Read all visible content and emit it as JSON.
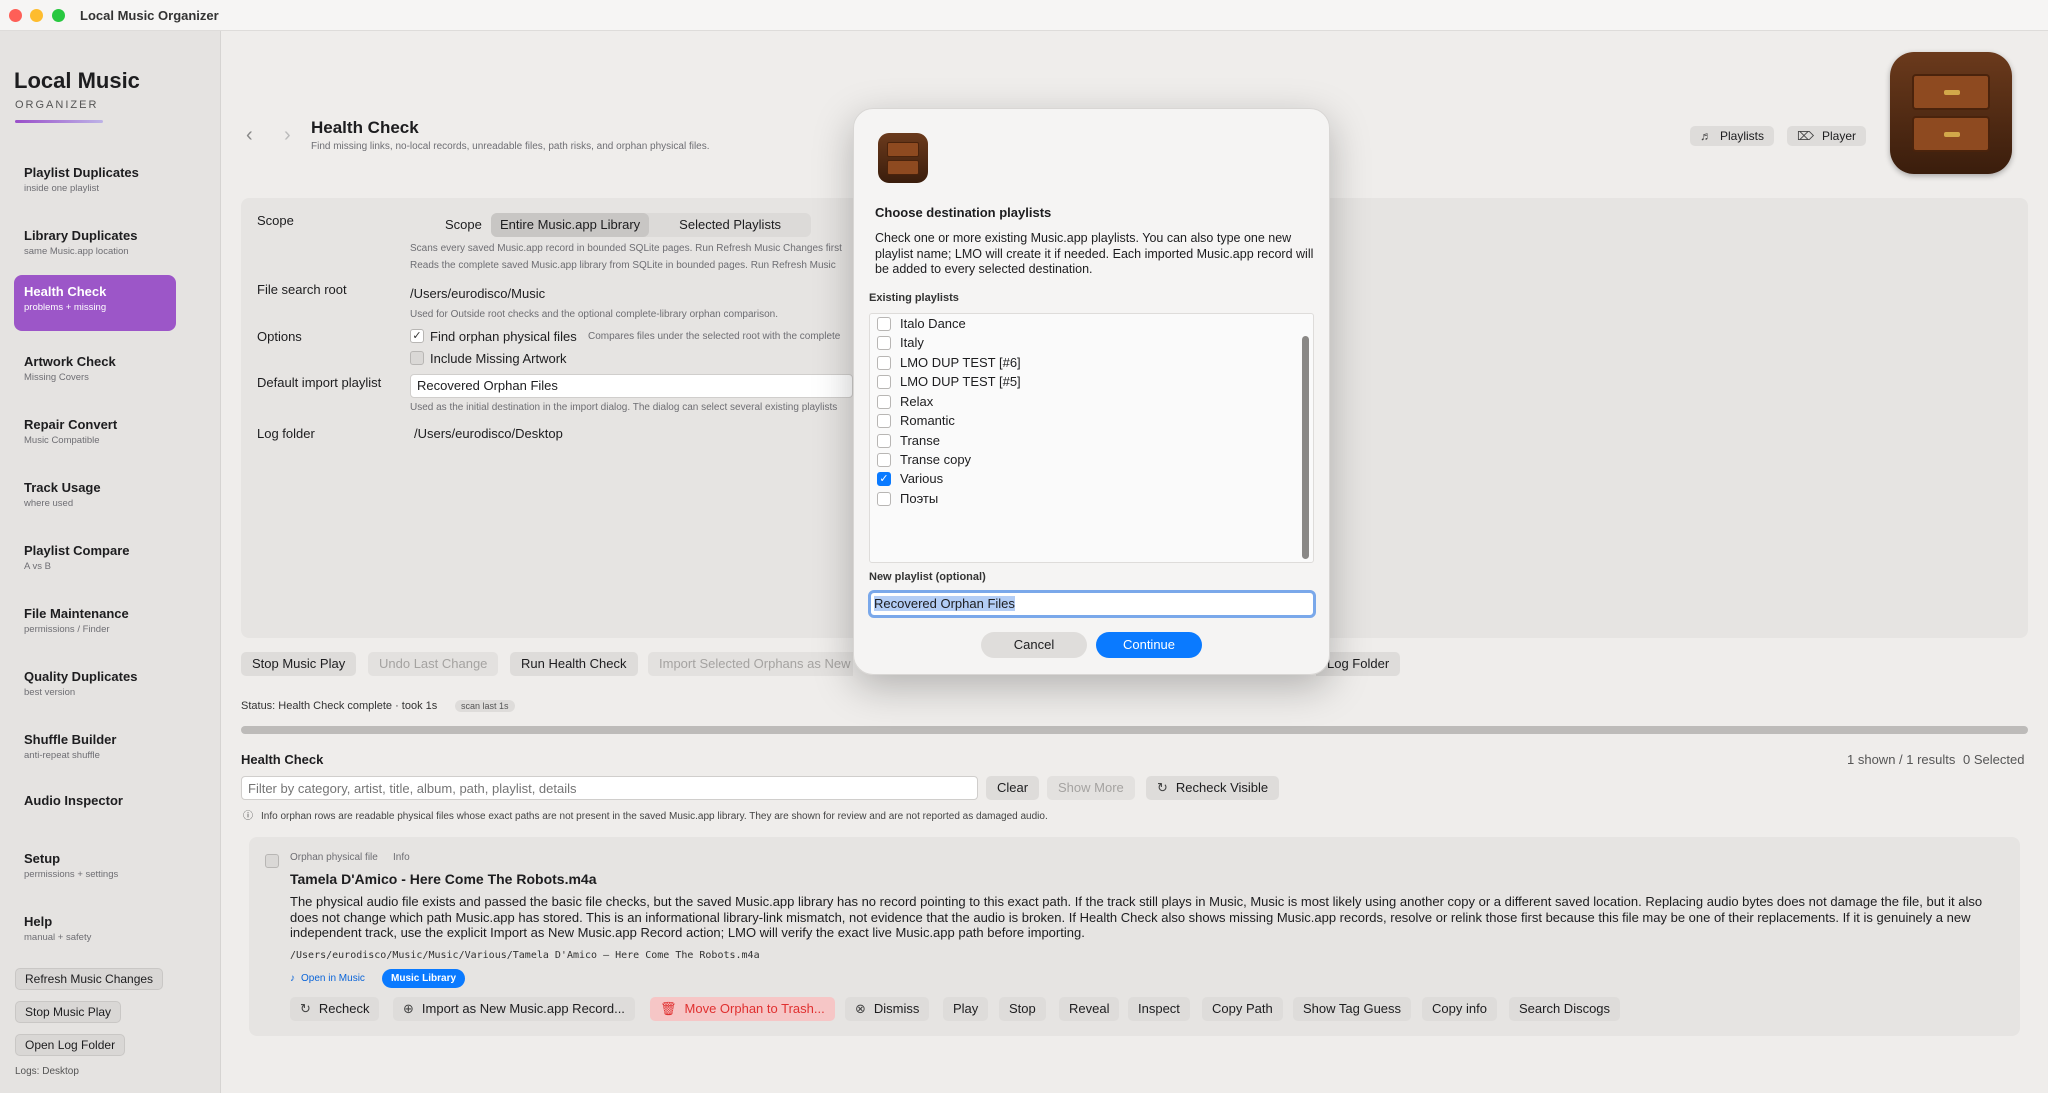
{
  "window": {
    "title": "Local Music Organizer"
  },
  "brand": {
    "line1": "Local Music",
    "line2": "ORGANIZER"
  },
  "sidebar": {
    "items": [
      {
        "title": "Playlist Duplicates",
        "sub": "inside one playlist"
      },
      {
        "title": "Library Duplicates",
        "sub": "same Music.app location"
      },
      {
        "title": "Health Check",
        "sub": "problems + missing"
      },
      {
        "title": "Artwork Check",
        "sub": "Missing Covers"
      },
      {
        "title": "Repair Convert",
        "sub": "Music Compatible"
      },
      {
        "title": "Track Usage",
        "sub": "where used"
      },
      {
        "title": "Playlist Compare",
        "sub": "A vs B"
      },
      {
        "title": "File Maintenance",
        "sub": "permissions / Finder"
      },
      {
        "title": "Quality Duplicates",
        "sub": "best version"
      },
      {
        "title": "Shuffle Builder",
        "sub": "anti-repeat shuffle"
      },
      {
        "title": "Audio Inspector",
        "sub": ""
      },
      {
        "title": "Setup",
        "sub": "permissions + settings"
      },
      {
        "title": "Help",
        "sub": "manual + safety"
      }
    ],
    "buttons": {
      "refresh": "Refresh Music Changes",
      "stop": "Stop Music Play",
      "openlog": "Open Log Folder"
    },
    "logs": "Logs: Desktop"
  },
  "header": {
    "title": "Health Check",
    "subtitle": "Find missing links, no-local records, unreadable files, path risks, and orphan physical files.",
    "playlists": "Playlists",
    "player": "Player"
  },
  "settings": {
    "scope_label": "Scope",
    "scope_inline": "Scope",
    "scope_options": [
      "Entire Music.app Library",
      "Selected Playlists"
    ],
    "scope_help1": "Scans every saved Music.app record in bounded SQLite pages. Run Refresh Music Changes first",
    "scope_help2": "Reads the complete saved Music.app library from SQLite in bounded pages. Run Refresh Music",
    "root_label": "File search root",
    "root_value": "/Users/eurodisco/Music",
    "root_help": "Used for Outside root checks and the optional complete-library orphan comparison.",
    "options_label": "Options",
    "opt1": "Find orphan physical files",
    "opt1_help": "Compares files under the selected root with the complete",
    "opt2": "Include Missing Artwork",
    "import_label": "Default import playlist",
    "import_value": "Recovered Orphan Files",
    "import_help": "Used as the initial destination in the import dialog. The dialog can select several existing playlists",
    "log_label": "Log folder",
    "log_value": "/Users/eurodisco/Desktop"
  },
  "actions": {
    "stop": "Stop Music Play",
    "undo": "Undo Last Change",
    "run": "Run Health Check",
    "import": "Import Selected Orphans as New",
    "logfolder": "Log Folder"
  },
  "status": {
    "text": "Status: Health Check complete · took 1s",
    "badge": "scan last 1s"
  },
  "results": {
    "title": "Health Check",
    "shown": "1 shown / 1 results",
    "selected": "0 Selected",
    "filter_placeholder": "Filter by category, artist, title, album, path, playlist, details",
    "clear": "Clear",
    "show_more": "Show More",
    "recheck_visible": "Recheck Visible",
    "info": "Info orphan rows are readable physical files whose exact paths are not present in the saved Music.app library. They are shown for review and are not reported as damaged audio."
  },
  "card": {
    "category": "Orphan physical file",
    "severity": "Info",
    "title": "Tamela D'Amico - Here Come The Robots.m4a",
    "body": "The physical audio file exists and passed the basic file checks, but the saved Music.app library has no record pointing to this exact path. If the track still plays in Music, Music is most likely using another copy or a different saved location. Replacing audio bytes does not damage the file, but it also does not change which path Music.app has stored. This is an informational library-link mismatch, not evidence that the audio is broken. If Health Check also shows missing Music.app records, resolve or relink those first because this file may be one of their replacements. If it is genuinely a new independent track, use the explicit Import as New Music.app Record action; LMO will verify the exact live Music.app path before importing.",
    "path": "/Users/eurodisco/Music/Music/Various/Tamela D'Amico — Here Come The Robots.m4a",
    "open_in_music": "Open in Music",
    "library_pill": "Music Library",
    "buttons": {
      "recheck": "Recheck",
      "import": "Import as New Music.app Record...",
      "trash": "Move Orphan to Trash...",
      "dismiss": "Dismiss",
      "play": "Play",
      "stop": "Stop",
      "reveal": "Reveal",
      "inspect": "Inspect",
      "copy_path": "Copy Path",
      "tag_guess": "Show Tag Guess",
      "copy_info": "Copy info",
      "discogs": "Search Discogs"
    }
  },
  "dialog": {
    "title": "Choose destination playlists",
    "text": "Check one or more existing Music.app playlists. You can also type one new playlist name; LMO will create it if needed. Each imported Music.app record will be added to every selected destination.",
    "existing_label": "Existing playlists",
    "playlists": [
      {
        "name": "Italo Dance",
        "checked": false
      },
      {
        "name": "Italy",
        "checked": false
      },
      {
        "name": "LMO DUP TEST [#6]",
        "checked": false
      },
      {
        "name": "LMO DUP TEST [#5]",
        "checked": false
      },
      {
        "name": "Relax",
        "checked": false
      },
      {
        "name": "Romantic",
        "checked": false
      },
      {
        "name": "Transe",
        "checked": false
      },
      {
        "name": "Transe copy",
        "checked": false
      },
      {
        "name": "Various",
        "checked": true
      },
      {
        "name": "Поэты",
        "checked": false
      }
    ],
    "new_label": "New playlist (optional)",
    "new_value": "Recovered Orphan Files",
    "cancel": "Cancel",
    "continue": "Continue"
  },
  "colors": {
    "accent": "#9c56c8",
    "blue": "#0a7aff",
    "danger": "#e03030"
  }
}
